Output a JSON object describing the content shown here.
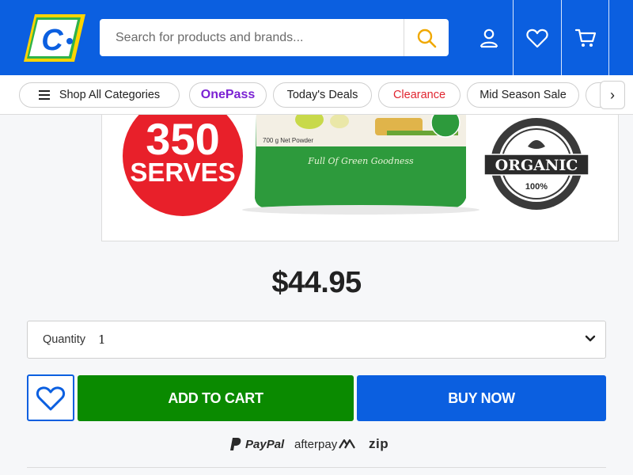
{
  "header": {
    "logo_letter": "C",
    "search": {
      "placeholder": "Search for products and brands..."
    },
    "icons": [
      "search-icon",
      "account-icon",
      "wishlist-heart-icon",
      "cart-icon"
    ]
  },
  "categories": {
    "shop_all": "Shop All Categories",
    "onepass": "OnePass",
    "todays_deals": "Today's Deals",
    "clearance": "Clearance",
    "mid_season": "Mid Season Sale",
    "next": "›"
  },
  "product": {
    "image": {
      "serves_number": "350",
      "serves_word": "SERVES",
      "pack_weight": "700 g Net Powder",
      "pack_tagline": "Full Of Green Goodness",
      "badge_word": "ORGANIC",
      "badge_pct": "100%"
    },
    "price": "$44.95",
    "quantity": {
      "label": "Quantity",
      "value": "1"
    },
    "add_to_cart": "ADD TO CART",
    "buy_now": "BUY NOW"
  },
  "payments": {
    "paypal": "PayPal",
    "afterpay": "afterpay",
    "zip": "zip"
  },
  "colors": {
    "brand_blue": "#0b5fe0",
    "cart_green": "#0a8a00",
    "clearance_red": "#e0252f",
    "onepass_purple": "#7b22d3",
    "logo_yellow": "#ffd400"
  }
}
